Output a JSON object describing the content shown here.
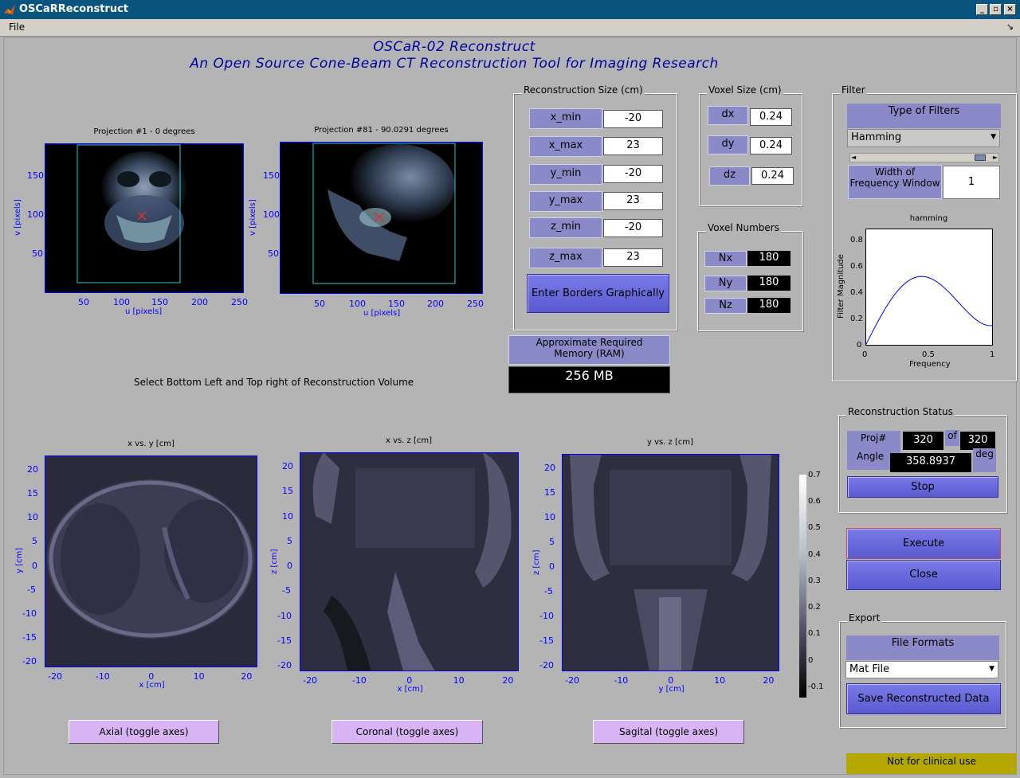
{
  "window": {
    "title": "OSCaRReconstruct"
  },
  "menu": {
    "file": "File",
    "grip": "↘"
  },
  "header": {
    "line1": "OSCaR-02 Reconstruct",
    "line2": "An Open Source Cone-Beam CT Reconstruction Tool for Imaging Research"
  },
  "projections": [
    {
      "title": "Projection #1 - 0 degrees",
      "xlabel": "u [pixels]",
      "ylabel": "v [pixels]",
      "xticks": [
        "50",
        "100",
        "150",
        "200",
        "250"
      ],
      "yticks": [
        "150",
        "100",
        "50"
      ]
    },
    {
      "title": "Projection #81 - 90.0291 degrees",
      "xlabel": "u [pixels]",
      "ylabel": "v [pixels]",
      "xticks": [
        "50",
        "100",
        "150",
        "200",
        "250"
      ],
      "yticks": [
        "150",
        "100",
        "50"
      ]
    }
  ],
  "select_instruction": "Select Bottom Left and Top right of Reconstruction Volume",
  "recon_size": {
    "label": "Reconstruction Size (cm)",
    "fields": [
      {
        "name": "x_min",
        "value": "-20"
      },
      {
        "name": "x_max",
        "value": "23"
      },
      {
        "name": "y_min",
        "value": "-20"
      },
      {
        "name": "y_max",
        "value": "23"
      },
      {
        "name": "z_min",
        "value": "-20"
      },
      {
        "name": "z_max",
        "value": "23"
      }
    ],
    "button": "Enter Borders Graphically"
  },
  "voxel_size": {
    "label": "Voxel Size (cm)",
    "fields": [
      {
        "name": "dx",
        "value": "0.24"
      },
      {
        "name": "dy",
        "value": "0.24"
      },
      {
        "name": "dz",
        "value": "0.24"
      }
    ]
  },
  "voxel_numbers": {
    "label": "Voxel Numbers",
    "fields": [
      {
        "name": "Nx",
        "value": "180"
      },
      {
        "name": "Ny",
        "value": "180"
      },
      {
        "name": "Nz",
        "value": "180"
      }
    ]
  },
  "memory": {
    "label": "Approximate Required Memory  (RAM)",
    "value": "256 MB"
  },
  "filter": {
    "label": "Filter",
    "type_label": "Type of Filters",
    "type_value": "Hamming",
    "width_label": "Width of Frequency Window",
    "width_value": "1",
    "plot_title": "hamming",
    "xlabel": "Frequency",
    "ylabel": "Filter Magnitude",
    "xticks": [
      "0",
      "0.5",
      "1"
    ],
    "yticks": [
      "0.8",
      "0.6",
      "0.4",
      "0.2",
      "0"
    ]
  },
  "status": {
    "label": "Reconstruction Status",
    "proj_label": "Proj#",
    "proj_value": "320",
    "of_label": "of",
    "total_value": "320",
    "angle_label": "Angle",
    "angle_value": "358.8937",
    "deg_label": "deg",
    "stop": "Stop"
  },
  "execute": "Execute",
  "close": "Close",
  "export": {
    "label": "Export",
    "formats_label": "File Formats",
    "format_value": "Mat File",
    "save": "Save Reconstructed Data"
  },
  "views": [
    {
      "title": "x vs. y [cm]",
      "xlabel": "x [cm]",
      "ylabel": "y [cm]",
      "xticks": [
        "-20",
        "-10",
        "0",
        "10",
        "20"
      ],
      "yticks": [
        "20",
        "15",
        "10",
        "5",
        "0",
        "-5",
        "-10",
        "-15",
        "-20"
      ],
      "button": "Axial (toggle axes)"
    },
    {
      "title": "x vs. z [cm]",
      "xlabel": "x [cm]",
      "ylabel": "z [cm]",
      "xticks": [
        "-20",
        "-10",
        "0",
        "10",
        "20"
      ],
      "yticks": [
        "20",
        "15",
        "10",
        "5",
        "0",
        "-5",
        "-10",
        "-15",
        "-20"
      ],
      "button": "Coronal (toggle axes)"
    },
    {
      "title": "y vs. z [cm]",
      "xlabel": "y [cm]",
      "ylabel": "z [cm]",
      "xticks": [
        "-20",
        "-10",
        "0",
        "10",
        "20"
      ],
      "yticks": [
        "20",
        "15",
        "10",
        "5",
        "0",
        "-5",
        "-10",
        "-15",
        "-20"
      ],
      "button": "Sagital (toggle axes)"
    }
  ],
  "colorbar_ticks": [
    "0.7",
    "0.6",
    "0.5",
    "0.4",
    "0.3",
    "0.2",
    "0.1",
    "0",
    "-0.1"
  ],
  "footer": "Not for clinical use",
  "colors": {
    "accent": "#7a7ae8",
    "label_bg": "#8a8ac8",
    "title_text": "#0000a0",
    "window_title": "#0a5480"
  }
}
